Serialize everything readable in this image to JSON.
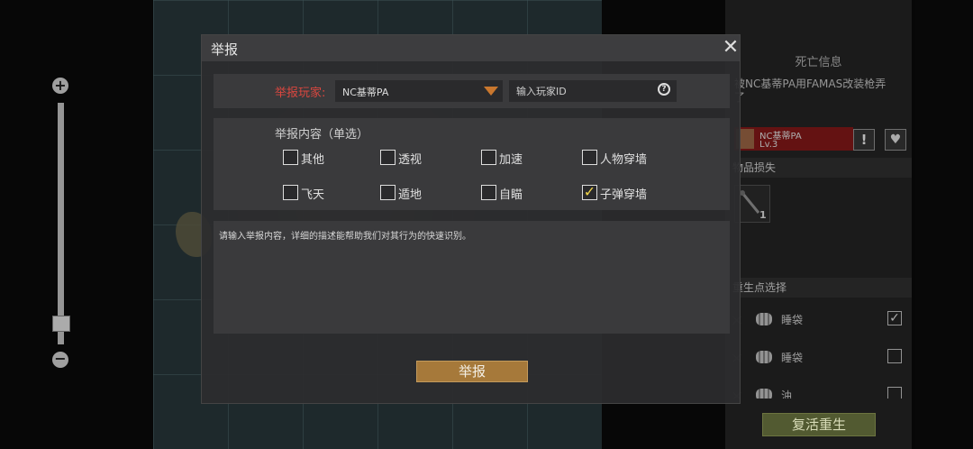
{
  "dialog": {
    "title": "举报",
    "report_player_label": "举报玩家:",
    "player_select_value": "NC基蒂PA",
    "player_id_placeholder": "输入玩家ID",
    "content_label": "举报内容（单选）",
    "options": [
      {
        "label": "其他",
        "checked": false
      },
      {
        "label": "透视",
        "checked": false
      },
      {
        "label": "加速",
        "checked": false
      },
      {
        "label": "人物穿墙",
        "checked": false
      },
      {
        "label": "飞天",
        "checked": false
      },
      {
        "label": "遁地",
        "checked": false
      },
      {
        "label": "自瞄",
        "checked": false
      },
      {
        "label": "子弹穿墙",
        "checked": true
      }
    ],
    "detail_placeholder": "请输入举报内容，详细的描述能帮助我们对其行为的快速识别。",
    "submit_label": "举报",
    "close_icon": "close-icon",
    "search_icon_glyph": "?"
  },
  "death_panel": {
    "title": "死亡信息",
    "message_line1": "被NC基蒂PA用FAMAS改装枪弄",
    "message_line2": "了",
    "killer_name": "NC基蒂PA",
    "killer_level": "Lv.3",
    "report_icon_glyph": "!",
    "heart_icon_glyph": "♥",
    "loss_title": "物品损失",
    "loss_item_count": "1",
    "respawn_title": "重生点选择",
    "respawn_options": [
      {
        "label": "睡袋",
        "checked": true
      },
      {
        "label": "睡袋",
        "checked": false
      },
      {
        "label": "油",
        "checked": false
      }
    ],
    "revive_label": "复活重生"
  },
  "zoom": {
    "plus": "+",
    "minus": "−",
    "level": 0.06
  },
  "colors": {
    "accent_red": "#d9473f",
    "checkbox_check": "#f2d64b",
    "submit_bg": "#a6793a",
    "revive_bg": "#525a31"
  }
}
